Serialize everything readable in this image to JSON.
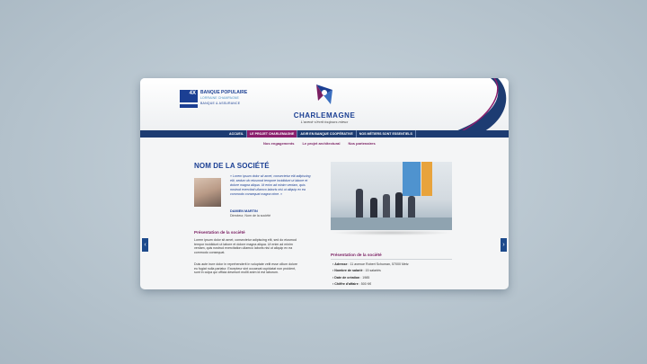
{
  "brand": {
    "bp_badge": "4X",
    "bp_line1": "BANQUE POPULAIRE",
    "bp_line2": "LORRAINE CHAMPAGNE",
    "bp_line3": "BANQUE & ASSURANCE",
    "name": "CHARLEMAGNE",
    "tagline": "L'avenir s'écrit toujours mieux"
  },
  "nav": {
    "items": [
      {
        "label": "ACCUEIL"
      },
      {
        "label": "LE PROJET CHARLEMAGNE"
      },
      {
        "label": "AGIR EN BANQUE COOPÉRATIVE"
      },
      {
        "label": "NOS MÉTIERS SONT ESSENTIELS"
      }
    ]
  },
  "subnav": {
    "items": [
      {
        "label": "Nos engagements"
      },
      {
        "label": "Le projet architectural"
      },
      {
        "label": "Nos partenaires"
      }
    ]
  },
  "page": {
    "title": "NOM DE LA SOCIÉTÉ",
    "quote": "« Lorem ipsum dolor sit amet, consectetur elit adipiscing elit, sedum do eiusmod tempore incididunt ut labore et dolore magna aliqua. Ut enim ad minim veniam, quis nostrud exercitati ullamco laboris nisi ut aliquip ex ea commodo consequat magna nime. »",
    "person_name": "DAMIEN MARTIN",
    "person_role": "Directeur, Nom de la société",
    "section_heading": "Présentation de la société",
    "para1": "Lorem ipsum dolor sit amet, consectetur adipiscing elit, sed do eiusmod tempor incididunt ut labore et dolore magna aliqua. Ut enim ad minim veniam, quis nostrud exercitation ullamco laboris nisi ut aliquip ex ea commodo consequat.",
    "para2": "Duis aute irure dolor in reprehenderit in voluptate velit esse cillum dolore eu fugiat nulla pariatur. Excepteur sint occaecat cupidatat non proident, sunt in culpa qui officia deserunt mollit anim id est laborum.",
    "info_heading": "Présentation de la société",
    "info": {
      "adresse_label": "Adresse",
      "adresse_value": "11 avenue Robert Schuman, 57000 Metz",
      "salaries_label": "Nombre de salarié",
      "salaries_value": "15 salariés",
      "creation_label": "Date de création",
      "creation_value": "1985",
      "ca_label": "Chiffre d'affaire",
      "ca_value": "500 K€"
    }
  },
  "controls": {
    "prev": "‹",
    "next": "›"
  },
  "colors": {
    "primary": "#1b3f93",
    "accent": "#7a1f62",
    "nav_bg": "#1d3c72",
    "nav_active": "#8a1f6d"
  }
}
